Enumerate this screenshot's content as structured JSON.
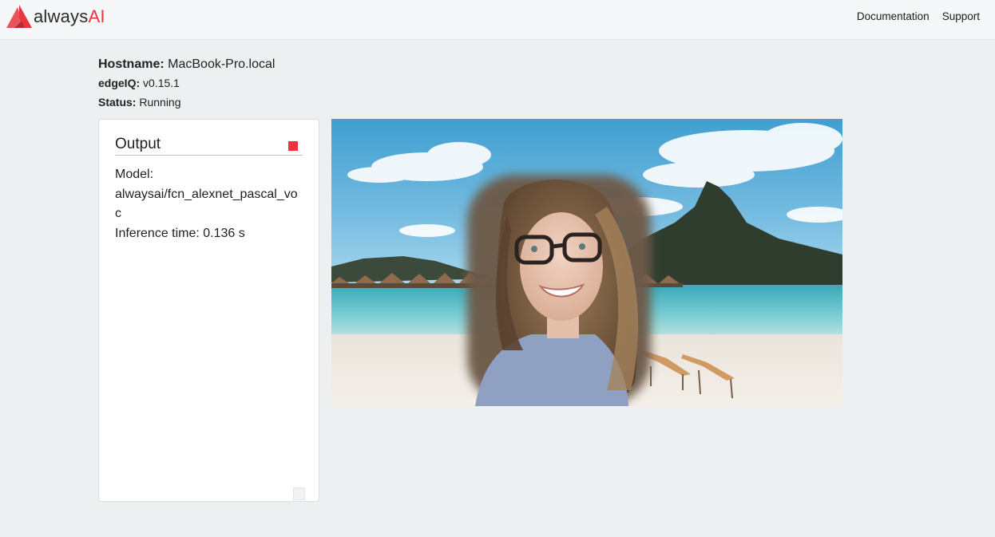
{
  "brand": {
    "logo_text_prefix": "always",
    "logo_text_suffix": "AI",
    "accent_color": "#e8363f"
  },
  "nav": {
    "documentation_label": "Documentation",
    "support_label": "Support"
  },
  "info": {
    "hostname_label": "Hostname:",
    "hostname_value": "MacBook-Pro.local",
    "edgeiq_label": "edgeIQ:",
    "edgeiq_value": "v0.15.1",
    "status_label": "Status:",
    "status_value": "Running"
  },
  "output": {
    "title": "Output",
    "stop_icon": "stop-square-icon",
    "model_label": "Model:",
    "model_value": "alwaysai/fcn_alexnet_pascal_voc",
    "inference_label": "Inference time: 0.136 s"
  },
  "video": {
    "content": "segmented-webcam-frame-beach-background"
  }
}
